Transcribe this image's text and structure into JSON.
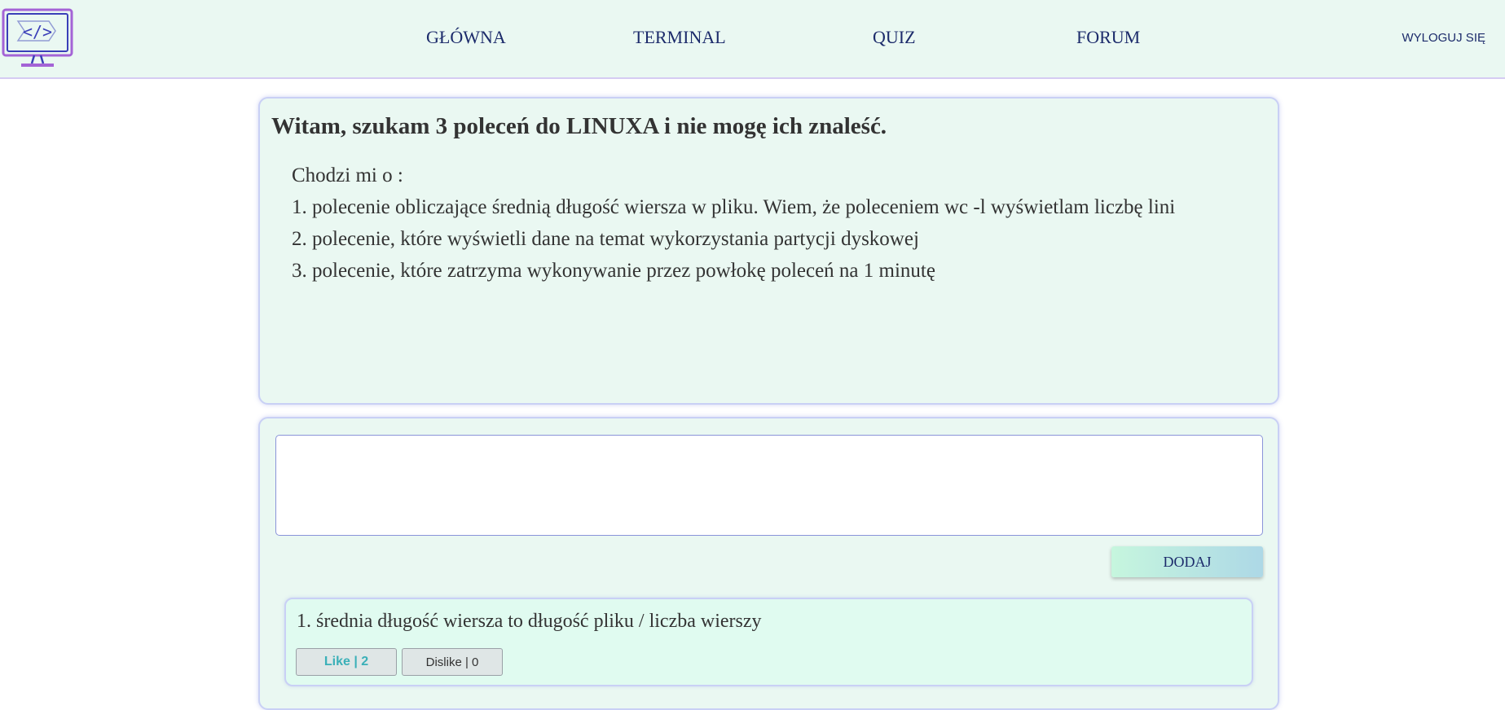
{
  "nav": {
    "logo_icon": "code-monitor-icon",
    "items": [
      {
        "label": "GŁÓWNA"
      },
      {
        "label": "TERMINAL"
      },
      {
        "label": "QUIZ"
      },
      {
        "label": "FORUM"
      }
    ],
    "logout_label": "WYLOGUJ SIĘ"
  },
  "post": {
    "title": "Witam, szukam 3 poleceń do LINUXA i nie mogę ich znaleść.",
    "body_lines": [
      "Chodzi mi o :",
      "1. polecenie obliczające średnią długość wiersza w pliku. Wiem, że poleceniem wc -l wyświetlam liczbę lini",
      "2. polecenie, które wyświetli dane na temat wykorzystania partycji dyskowej",
      "3. polecenie, które zatrzyma wykonywanie przez powłokę poleceń na 1 minutę"
    ]
  },
  "comment_form": {
    "input_value": "",
    "add_label": "DODAJ"
  },
  "comments": [
    {
      "text": "1. średnia długość wiersza to długość pliku / liczba wierszy",
      "like_label": "Like | 2",
      "dislike_label": "Dislike | 0"
    }
  ],
  "colors": {
    "nav_bg": "#eaf8f2",
    "card_bg": "#eaf8f2",
    "card_border": "#c9d0f5",
    "nav_text": "#1c2b6b",
    "like_text": "#3ab0b8",
    "logo_purple": "#a463d6",
    "logo_blue": "#3a3fb8"
  }
}
